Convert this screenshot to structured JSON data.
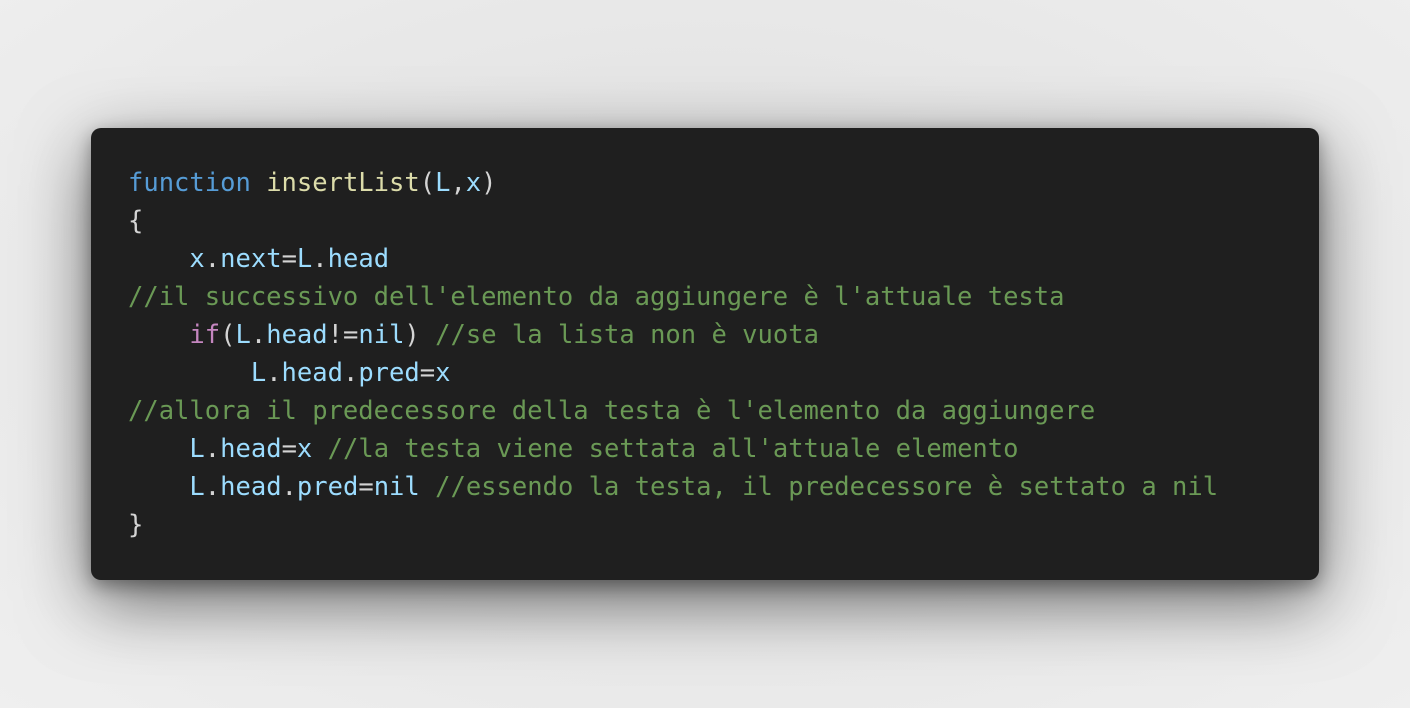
{
  "colors": {
    "keyword": "#569cd6",
    "function": "#dcdcaa",
    "variable": "#9cdcfe",
    "punctuation": "#d4d4d4",
    "control": "#c586c0",
    "comment": "#6a9955",
    "background": "#1f1f1f"
  },
  "code": {
    "l1": {
      "kw": "function",
      "fn": "insertList",
      "p1": "(",
      "a1": "L",
      "p2": ",",
      "a2": "x",
      "p3": ")"
    },
    "l2": {
      "brace": "{"
    },
    "l3": {
      "indent": "    ",
      "v1": "x",
      "d1": ".",
      "v2": "next",
      "eq": "=",
      "v3": "L",
      "d2": ".",
      "v4": "head"
    },
    "l4": {
      "comment": "//il successivo dell'elemento da aggiungere è l'attuale testa"
    },
    "l5": {
      "indent": "    ",
      "ctrl": "if",
      "p1": "(",
      "v1": "L",
      "d1": ".",
      "v2": "head",
      "op": "!=",
      "v3": "nil",
      "p2": ")",
      "sp": " ",
      "comment": "//se la lista non è vuota"
    },
    "l6": {
      "indent": "        ",
      "v1": "L",
      "d1": ".",
      "v2": "head",
      "d2": ".",
      "v3": "pred",
      "eq": "=",
      "v4": "x"
    },
    "l7": {
      "comment": "//allora il predecessore della testa è l'elemento da aggiungere"
    },
    "l8": {
      "indent": "    ",
      "v1": "L",
      "d1": ".",
      "v2": "head",
      "eq": "=",
      "v3": "x",
      "sp": " ",
      "comment": "//la testa viene settata all'attuale elemento"
    },
    "l9": {
      "indent": "    ",
      "v1": "L",
      "d1": ".",
      "v2": "head",
      "d2": ".",
      "v3": "pred",
      "eq": "=",
      "v4": "nil",
      "sp": " ",
      "comment": "//essendo la testa, il predecessore è settato a nil"
    },
    "l10": {
      "brace": "}"
    }
  }
}
